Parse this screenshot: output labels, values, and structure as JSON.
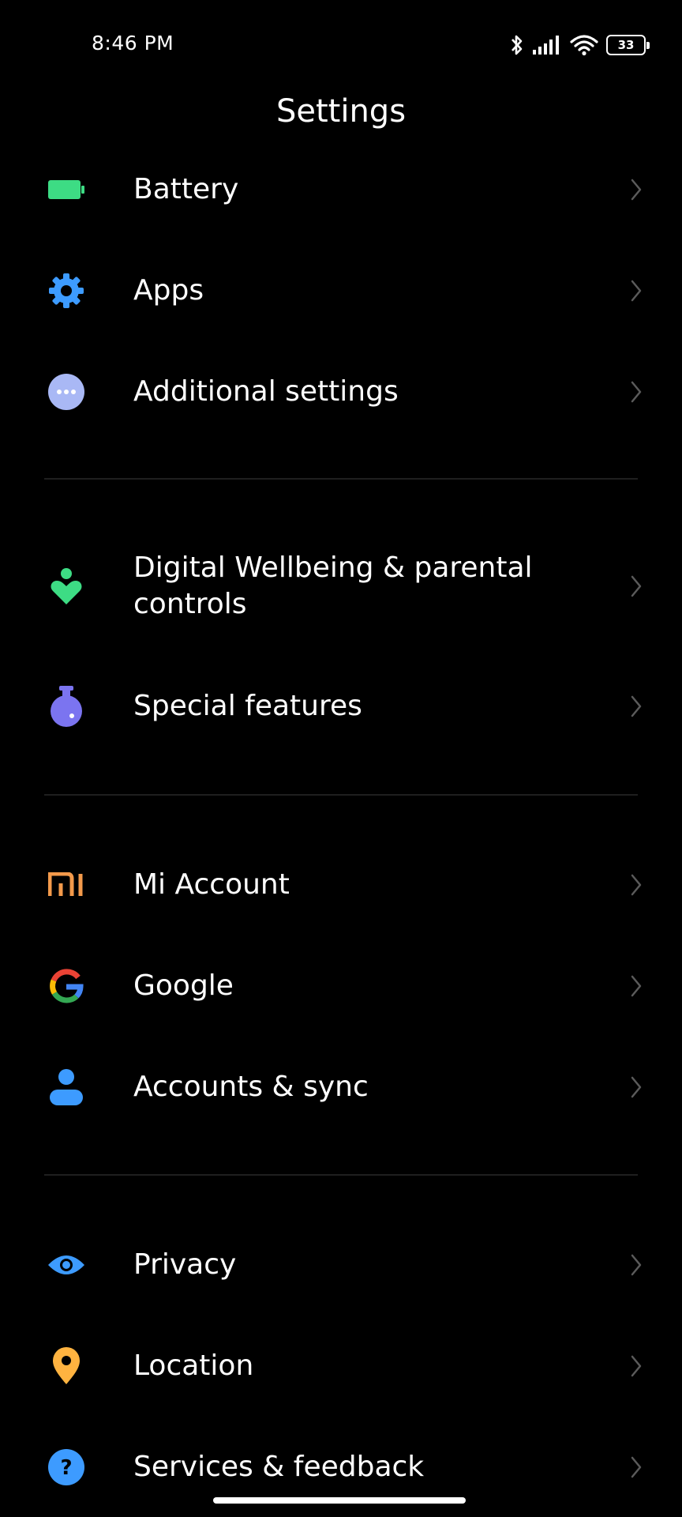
{
  "status_bar": {
    "time": "8:46 PM",
    "battery_level": "33",
    "icons": [
      "bluetooth-icon",
      "signal-icon",
      "wifi-icon",
      "battery-icon"
    ]
  },
  "header": {
    "title": "Settings"
  },
  "sections": [
    {
      "items": [
        {
          "label": "Battery",
          "icon": "battery-icon",
          "color": "#3ddc84"
        },
        {
          "label": "Apps",
          "icon": "gear-icon",
          "color": "#3d9bff"
        },
        {
          "label": "Additional settings",
          "icon": "more-dots-icon",
          "color": "#a9b8f5"
        }
      ]
    },
    {
      "items": [
        {
          "label": "Digital Wellbeing & parental controls",
          "icon": "wellbeing-heart-icon",
          "color": "#3ddc84"
        },
        {
          "label": "Special features",
          "icon": "potion-icon",
          "color": "#7b74f0"
        }
      ]
    },
    {
      "items": [
        {
          "label": "Mi Account",
          "icon": "mi-logo-icon",
          "color": "#f39a4b"
        },
        {
          "label": "Google",
          "icon": "google-g-icon",
          "color": "#4285f4"
        },
        {
          "label": "Accounts & sync",
          "icon": "person-icon",
          "color": "#3d9bff"
        }
      ]
    },
    {
      "items": [
        {
          "label": "Privacy",
          "icon": "eye-icon",
          "color": "#3d9bff"
        },
        {
          "label": "Location",
          "icon": "location-pin-icon",
          "color": "#ffb340"
        },
        {
          "label": "Services & feedback",
          "icon": "help-circle-icon",
          "color": "#3d9bff"
        }
      ]
    }
  ]
}
